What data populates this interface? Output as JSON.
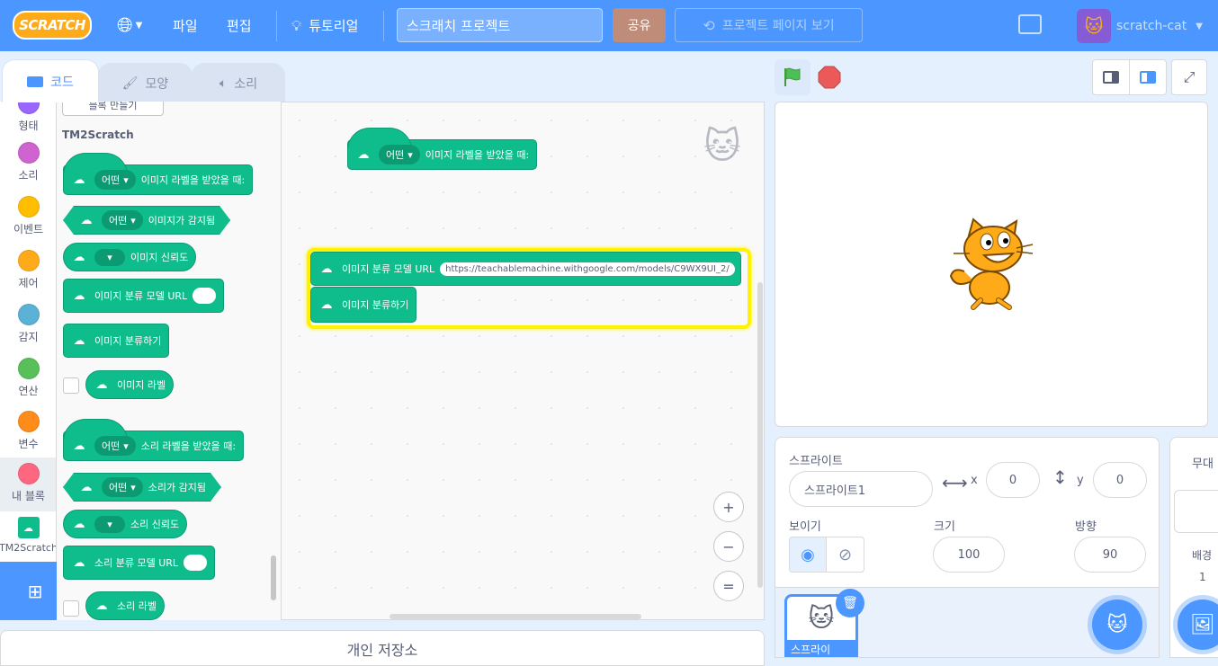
{
  "menubar": {
    "logo": "SCRATCH",
    "file": "파일",
    "edit": "편집",
    "tutorials": "튜토리얼",
    "project_title": "스크래치 프로젝트",
    "share": "공유",
    "see_project_page": "프로젝트 페이지 보기",
    "username": "scratch-cat"
  },
  "tabs": {
    "code": "코드",
    "costumes": "모양",
    "sounds": "소리"
  },
  "categories": [
    {
      "label": "형태",
      "color": "#9966ff"
    },
    {
      "label": "소리",
      "color": "#cf63cf"
    },
    {
      "label": "이벤트",
      "color": "#ffbf00"
    },
    {
      "label": "제어",
      "color": "#ffab19"
    },
    {
      "label": "감지",
      "color": "#5cb1d6"
    },
    {
      "label": "연산",
      "color": "#59c059"
    },
    {
      "label": "변수",
      "color": "#ff8c1a"
    },
    {
      "label": "내 블록",
      "color": "#ff6680"
    },
    {
      "label": "TM2Scratch",
      "color": "#0fbd8c"
    }
  ],
  "palette": {
    "make_block": "블록 만들기",
    "section_title": "TM2Scratch",
    "dropdown_any": "어떤",
    "img_when_label": "이미지 라벨을 받았을 때:",
    "img_detected": "이미지가 감지됨",
    "img_confidence": "이미지 신뢰도",
    "img_model_url": "이미지 분류 모델 URL",
    "img_classify": "이미지 분류하기",
    "img_label": "이미지 라벨",
    "snd_when_label": "소리 라벨을 받았을 때:",
    "snd_detected": "소리가 감지됨",
    "snd_confidence": "소리 신뢰도",
    "snd_model_url": "소리 분류 모델 URL",
    "snd_label": "소리 라벨"
  },
  "workspace": {
    "hat_dropdown": "어떤",
    "hat_text": "이미지 라벨을 받았을 때:",
    "url_block_text": "이미지 분류 모델 URL",
    "url_value": "https://teachablemachine.withgoogle.com/models/C9WX9UI_2/",
    "classify_text": "이미지 분류하기",
    "zoom_in": "+",
    "zoom_out": "−",
    "zoom_reset": "="
  },
  "sprite_info": {
    "sprite_label": "스프라이트",
    "name": "스프라이트1",
    "x_label": "x",
    "x_value": "0",
    "y_label": "y",
    "y_value": "0",
    "show_label": "보이기",
    "size_label": "크기",
    "size_value": "100",
    "direction_label": "방향",
    "direction_value": "90",
    "thumb_name": "스프라이"
  },
  "stage_panel": {
    "title": "무대",
    "backdrops_label": "배경",
    "backdrops_count": "1"
  },
  "backpack": "개인 저장소"
}
